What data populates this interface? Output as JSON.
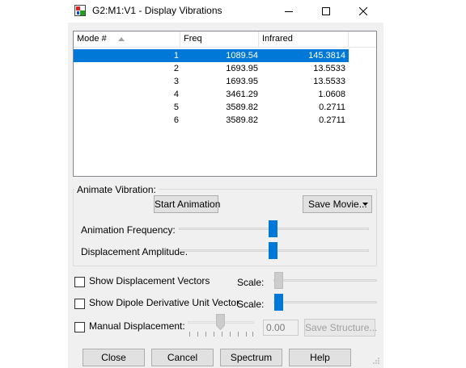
{
  "window": {
    "title": "G2:M1:V1 - Display Vibrations",
    "icon": "gaussview-app-icon",
    "controls": [
      "minimize-icon",
      "maximize-icon",
      "close-icon"
    ]
  },
  "table": {
    "columns": [
      "Mode #",
      "Freq",
      "Infrared"
    ],
    "sort_column": "Mode #",
    "selected_row": 0,
    "rows": [
      {
        "mode": "1",
        "freq": "1089.54",
        "ir": "145.3814"
      },
      {
        "mode": "2",
        "freq": "1693.95",
        "ir": "13.5533"
      },
      {
        "mode": "3",
        "freq": "1693.95",
        "ir": "13.5533"
      },
      {
        "mode": "4",
        "freq": "3461.29",
        "ir": "1.0608"
      },
      {
        "mode": "5",
        "freq": "3589.82",
        "ir": "0.2711"
      },
      {
        "mode": "6",
        "freq": "3589.82",
        "ir": "0.2711"
      }
    ]
  },
  "animate": {
    "group_label": "Animate Vibration:",
    "start_button": "Start Animation",
    "save_movie_button": "Save Movie...",
    "frequency_label": "Animation Frequency:",
    "frequency_level": 0.5,
    "amplitude_label": "Displacement Amplitude:",
    "amplitude_level": 0.5
  },
  "options": {
    "show_displacement_vectors": {
      "label": "Show Displacement Vectors",
      "checked": false,
      "scale_label": "Scale:",
      "scale_enabled": false
    },
    "show_dipole_vector": {
      "label": "Show Dipole Derivative Unit Vector",
      "checked": false,
      "scale_label": "Scale:",
      "scale_enabled": true
    },
    "manual_displacement": {
      "label": "Manual Displacement:",
      "checked": false,
      "value": "0.00",
      "save_structure_button": "Save Structure..."
    }
  },
  "footer": {
    "close": "Close",
    "cancel": "Cancel",
    "spectrum": "Spectrum",
    "help": "Help"
  },
  "colors": {
    "selection": "#0078d7",
    "slider_thumb": "#0078d7",
    "window_bg": "#f0f0f0"
  }
}
